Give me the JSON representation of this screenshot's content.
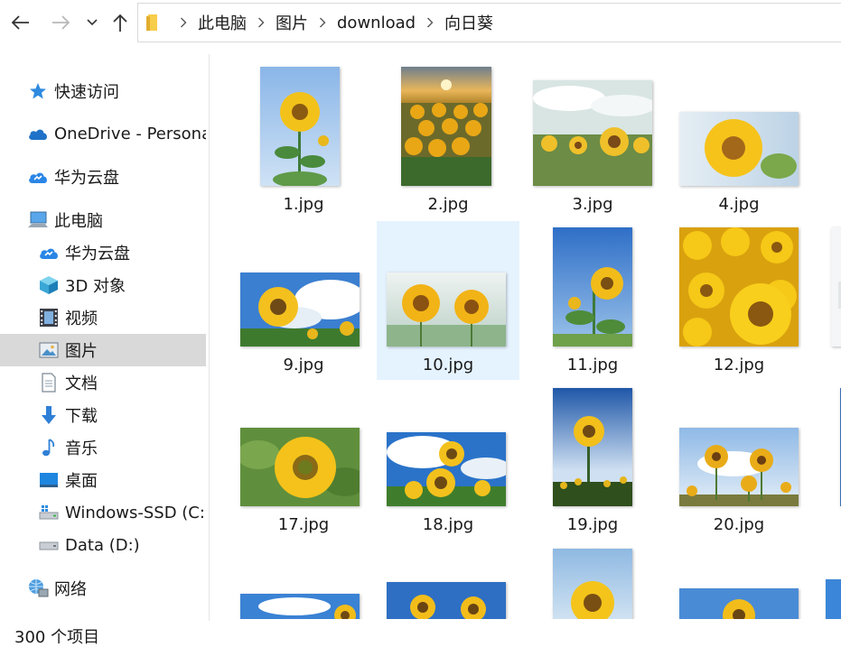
{
  "address": {
    "crumbs": [
      "此电脑",
      "图片",
      "download",
      "向日葵"
    ]
  },
  "nav_pane": {
    "quick_access": "快速访问",
    "onedrive": "OneDrive - Personal",
    "huawei_cloud": "华为云盘",
    "this_pc": "此电脑",
    "pc_huawei_cloud": "华为云盘",
    "objects_3d": "3D 对象",
    "videos": "视频",
    "pictures": "图片",
    "documents": "文档",
    "downloads": "下载",
    "music": "音乐",
    "desktop": "桌面",
    "drive_c": "Windows-SSD (C:)",
    "drive_d": "Data (D:)",
    "network": "网络"
  },
  "files": [
    {
      "name": "1.jpg"
    },
    {
      "name": "2.jpg"
    },
    {
      "name": "3.jpg"
    },
    {
      "name": "4.jpg"
    },
    {
      "name": "9.jpg"
    },
    {
      "name": "10.jpg"
    },
    {
      "name": "11.jpg"
    },
    {
      "name": "12.jpg"
    },
    {
      "name": "17.jpg"
    },
    {
      "name": "18.jpg"
    },
    {
      "name": "19.jpg"
    },
    {
      "name": "20.jpg"
    }
  ],
  "selected_file": "10.jpg",
  "status": {
    "item_count": "300 个项目"
  },
  "colors": {
    "selection_bg": "#e5f3ff",
    "nav_selected_bg": "#d9d9d9",
    "folder_yellow": "#f8cd4b",
    "accent_blue": "#2b7bd6"
  }
}
